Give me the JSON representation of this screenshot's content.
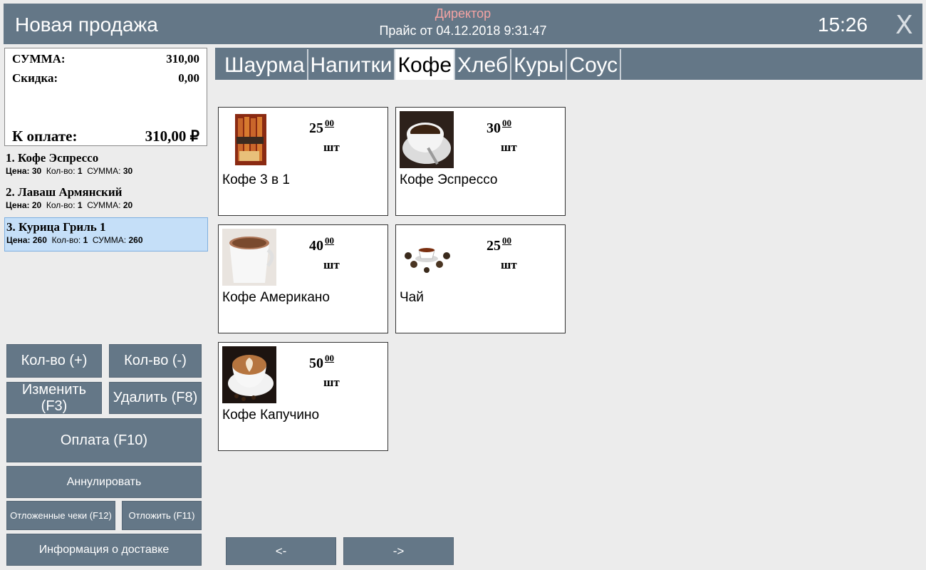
{
  "header": {
    "title": "Новая продажа",
    "role": "Директор",
    "price_list": "Прайс от 04.12.2018 9:31:47",
    "clock": "15:26",
    "close": "X"
  },
  "summary": {
    "sum_label": "СУММА:",
    "sum_value": "310,00",
    "discount_label": "Скидка:",
    "discount_value": "0,00",
    "topay_label": "К оплате:",
    "topay_value": "310,00 ₽"
  },
  "orders": [
    {
      "name": "1. Кофе Эспрессо",
      "price_label": "Цена:",
      "price": "30",
      "qty_label": "Кол-во:",
      "qty": "1",
      "sum_label": "СУММА:",
      "sum": "30"
    },
    {
      "name": "2. Лаваш Армянский",
      "price_label": "Цена:",
      "price": "20",
      "qty_label": "Кол-во:",
      "qty": "1",
      "sum_label": "СУММА:",
      "sum": "20"
    },
    {
      "name": "3. Курица Гриль 1",
      "price_label": "Цена:",
      "price": "260",
      "qty_label": "Кол-во:",
      "qty": "1",
      "sum_label": "СУММА:",
      "sum": "260"
    }
  ],
  "buttons": {
    "qty_plus": "Кол-во (+)",
    "qty_minus": "Кол-во (-)",
    "edit": "Изменить (F3)",
    "delete": "Удалить (F8)",
    "pay": "Оплата (F10)",
    "cancel": "Аннулировать",
    "deferred": "Отложенные чеки (F12)",
    "defer": "Отложить (F11)",
    "delivery": "Информация о доставке",
    "prev": "<-",
    "next": "->"
  },
  "tabs": [
    "Шаурма",
    "Напитки",
    "Кофе",
    "Хлеб",
    "Куры",
    "Соус"
  ],
  "active_tab": "Кофе",
  "products": [
    {
      "name": "Кофе 3 в 1",
      "price": "25",
      "cents": "00",
      "unit": "шт",
      "icon": "coffee-sachet-icon"
    },
    {
      "name": "Кофе Эспрессо",
      "price": "30",
      "cents": "00",
      "unit": "шт",
      "icon": "espresso-cup-icon"
    },
    {
      "name": "Кофе Американо",
      "price": "40",
      "cents": "00",
      "unit": "шт",
      "icon": "americano-cup-icon"
    },
    {
      "name": "Чай",
      "price": "25",
      "cents": "00",
      "unit": "шт",
      "icon": "tea-cup-icon"
    },
    {
      "name": "Кофе Капучино",
      "price": "50",
      "cents": "00",
      "unit": "шт",
      "icon": "cappuccino-cup-icon"
    }
  ],
  "colors": {
    "panel": "#647787",
    "background": "#ececec",
    "selected_row": "#c5dff8",
    "role_text": "#f3a3a3"
  }
}
